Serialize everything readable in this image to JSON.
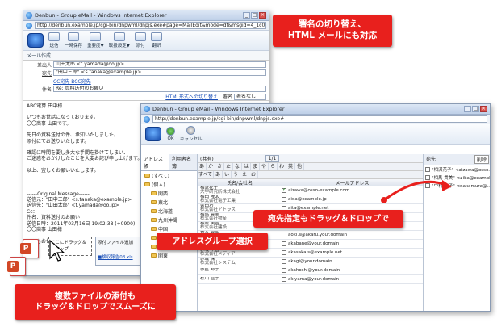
{
  "callouts": {
    "top": "署名の切り替え、\nHTML メールにも対応",
    "middle": "宛先指定もドラッグ＆ドロップで",
    "group": "アドレスグループ選択",
    "bottom": "複数ファイルの添付も\nドラッグ＆ドロップでスムーズに"
  },
  "colors": {
    "callout": "#e8201d",
    "accent": "#1a62c4"
  },
  "back_window": {
    "title": "Denbun - Group eMail - Windows Internet Explorer",
    "url": "http://denbun.example.jp/cgi-bin/dnpwml/dnpjs.exe#page=MailEdit&mode=df&msgid=4_1c05592gg6p",
    "toolbar": [
      "送信",
      "一時保存",
      "重要度▼",
      "取扱設定▼",
      "添付",
      "翻訳"
    ],
    "section": "メール作成",
    "from_label": "差出人",
    "from_value": "山田太郎 <t.yamada@oo.jp>",
    "to_label": "宛先",
    "to_value": "\"田中三郎\" <s.tanaka@example.jp>",
    "cc_link": "CC宛先 BCC宛先",
    "subject_label": "件名",
    "subject_value": "Re: 資料送付のお願い",
    "format_link": "HTML形式への切り替え",
    "sig_label": "署名",
    "sig_value": "署名なし",
    "body_lines": [
      "ABC電算 田中様",
      "",
      "いつもお世話になっております。",
      "〇〇商事 山田です。",
      "",
      "先日の資料送付の件、承知いたしました。",
      "添付にてお送りいたします。",
      "",
      "確認に時間を要し多大な手間を掛けてしまい、",
      "ご迷惑をおかけしたことを大変お詫び申し上げます。",
      "",
      "以上、宜しくお願いいたします。",
      "",
      "---------",
      "",
      "------Original Message------",
      "送信元：\"田中三郎\" <s.tanaka@example.jp>",
      "送信先：\"山田太郎\" <t.yamada@oo.jp>",
      "Cc：",
      "件名：資料送付のお願い",
      "送信日時：2011年03月16日 19:02:38 (+0900)",
      "〇〇商事 山田様",
      "",
      "いつもお世話に..."
    ],
    "drop_label": "ここにドラッグ＆ドロップ",
    "attach_title": "添付ファイル追加",
    "attach_link": "■検収報告08.xls"
  },
  "front_window": {
    "title": "Denbun - Group eMail - Windows Internet Explorer",
    "url": "http://denbun.example.jp/cgi-bin/dnpwml/dnpjs.exe#",
    "toolbar": [
      "OK",
      "キャンセル"
    ],
    "tabs": [
      "アドレス帳",
      "利用者名簿"
    ],
    "tree": [
      "(すべて)",
      "(個人)",
      "関西",
      "東北",
      "北海道",
      "九州沖縄",
      "中国",
      "四国",
      "中部",
      "関東"
    ],
    "filter_label": "(共有)",
    "pager": "1/1",
    "kana": [
      "あ",
      "か",
      "さ",
      "た",
      "な",
      "は",
      "ま",
      "や",
      "ら",
      "わ",
      "英",
      "他"
    ],
    "list_head": [
      "すべて",
      "あ",
      "い",
      "う",
      "え",
      "お"
    ],
    "col_name": "氏名/会社名",
    "col_mail": "メールアドレス",
    "rows": [
      {
        "name": "相沢花子",
        "company": "大学研究所株式会社",
        "mail": "aizawa@osso-example.com",
        "checked": true
      },
      {
        "name": "相田 隆太",
        "company": "株式会社電子工業",
        "mail": "aida@example.jp",
        "checked": false
      },
      {
        "name": "会田巧",
        "company": "株式会社アトラス",
        "mail": "aita@example.net",
        "checked": false
      },
      {
        "name": "相馬 貴美",
        "company": "株式会社物産",
        "mail": "aiba@example.jp",
        "checked": true
      },
      {
        "name": "相原 美香",
        "company": "株式会社建設",
        "mail": "aihara@example.jp",
        "checked": false
      },
      {
        "name": "青木 秀明",
        "company": "株式会社エンジニア",
        "mail": "aoki.s@akaru.your.domain",
        "checked": false
      },
      {
        "name": "赤羽 香",
        "company": "株式会社インテリア",
        "mail": "akabane@your.domain",
        "checked": false
      },
      {
        "name": "赤坂 早苗",
        "company": "株式会社メディア",
        "mail": "akasaka.s@example.net",
        "checked": false
      },
      {
        "name": "赤城 保",
        "company": "株式会社システム",
        "mail": "akagi@your.domain",
        "checked": false
      },
      {
        "name": "赤星 邦子",
        "company": "",
        "mail": "akahoshi@your.domain",
        "checked": false
      },
      {
        "name": "秋山 直子",
        "company": "",
        "mail": "akiyama@your.domain",
        "checked": false
      }
    ],
    "side_head": "宛先",
    "side_btn": "削除",
    "side_items": [
      "\"相沢花子\" <aizawa@osso...>",
      "\"相馬 貴美\" <aiba@example.jp>",
      "\"中村 直子\" <nakamura@...>"
    ]
  }
}
